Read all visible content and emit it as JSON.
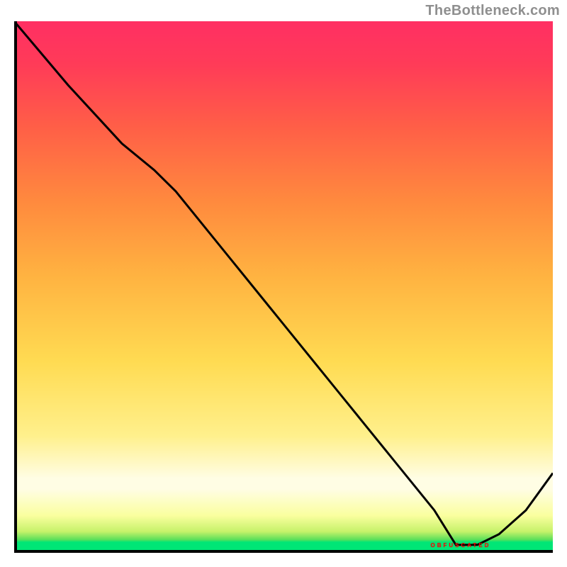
{
  "attribution": "TheBottleneck.com",
  "badge_text": "OBFUSCATED",
  "colors": {
    "curve": "#000000",
    "axis": "#000000"
  },
  "chart_data": {
    "type": "line",
    "title": "",
    "xlabel": "",
    "ylabel": "",
    "xlim": [
      0,
      100
    ],
    "ylim": [
      0,
      100
    ],
    "grid": false,
    "description": "Normalized bottleneck curve over a heat-style gradient background; large downward-sloping primary curve from top-left toward a minimum near x≈82, then a sharp rise to the right edge.",
    "series": [
      {
        "name": "curve",
        "x": [
          0,
          10,
          20,
          26,
          30,
          40,
          50,
          60,
          70,
          78,
          82,
          86,
          90,
          95,
          100
        ],
        "y": [
          100,
          88,
          77,
          72,
          68,
          55.5,
          43,
          30.5,
          18,
          8,
          1.5,
          1.5,
          3.5,
          8,
          15
        ]
      }
    ],
    "marker": {
      "x_range": [
        78,
        86
      ],
      "y": 1.5,
      "note": "flat minimum region with red obfuscated text badge"
    }
  }
}
